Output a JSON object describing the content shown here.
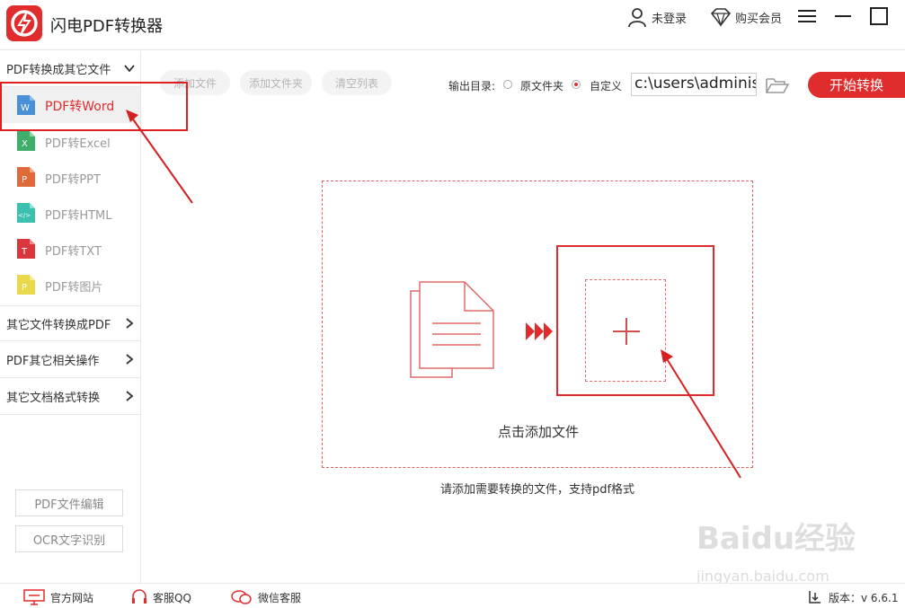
{
  "app": {
    "title": "闪电PDF转换器",
    "login_label": "未登录",
    "vip_label": "购买会员",
    "accent": "#e02c2c"
  },
  "sidebar": {
    "group1": "PDF转换成其它文件",
    "items": [
      {
        "label": "PDF转Word",
        "icon": "word-file-icon",
        "color": "#4a90d9",
        "active": true
      },
      {
        "label": "PDF转Excel",
        "icon": "excel-file-icon",
        "color": "#3fae6a",
        "active": false
      },
      {
        "label": "PDF转PPT",
        "icon": "ppt-file-icon",
        "color": "#e0693a",
        "active": false
      },
      {
        "label": "PDF转HTML",
        "icon": "html-file-icon",
        "color": "#3cc1b0",
        "active": false
      },
      {
        "label": "PDF转TXT",
        "icon": "txt-file-icon",
        "color": "#d9363e",
        "active": false
      },
      {
        "label": "PDF转图片",
        "icon": "image-file-icon",
        "color": "#e8d84a",
        "active": false
      }
    ],
    "group2": "其它文件转换成PDF",
    "group3": "PDF其它相关操作",
    "group4": "其它文档格式转换",
    "edit_button": "PDF文件编辑",
    "ocr_button": "OCR文字识别"
  },
  "toolbar": {
    "add_file": "添加文件",
    "add_folder": "添加文件夹",
    "clear_list": "清空列表",
    "output_label": "输出目录:",
    "option_original": "原文件夹",
    "option_custom": "自定义",
    "path_value": "c:\\users\\administ",
    "start_button": "开始转换"
  },
  "main": {
    "drop_text": "点击添加文件",
    "hint_text": "请添加需要转换的文件，支持pdf格式"
  },
  "footer": {
    "website": "官方网站",
    "qq": "客服QQ",
    "wechat": "微信客服",
    "version": "版本：v 6.6.1"
  },
  "watermark": {
    "line1": "Baidu经验",
    "line2": "jingyan.baidu.com"
  }
}
